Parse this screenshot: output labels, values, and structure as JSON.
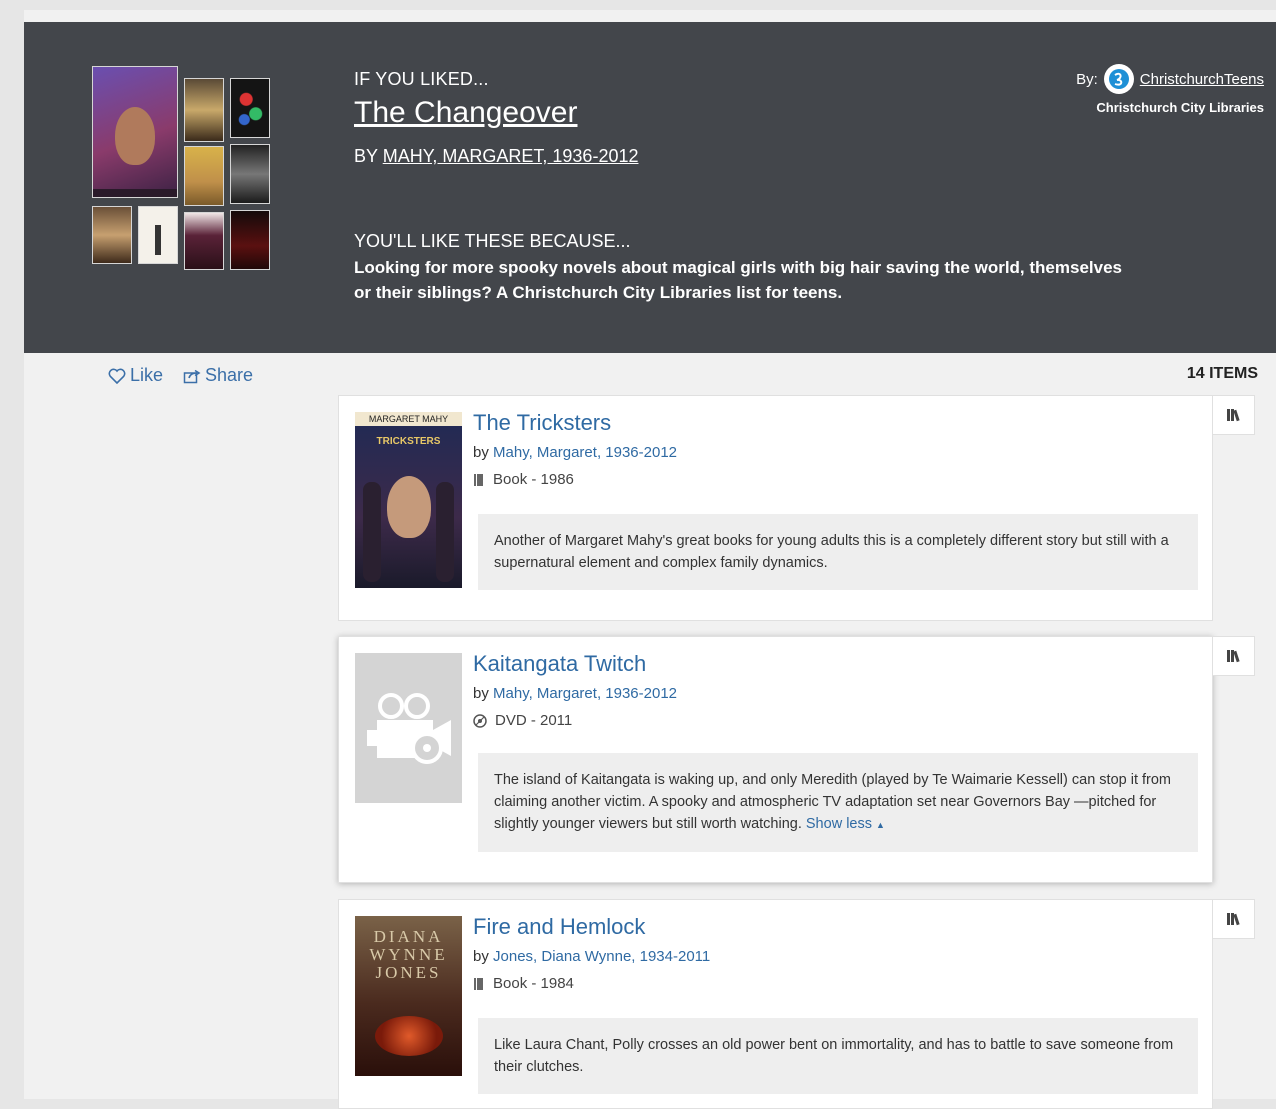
{
  "hero": {
    "label": "IF YOU LIKED...",
    "title": "The Changeover",
    "author_prefix": "BY",
    "author": "MAHY, MARGARET, 1936-2012",
    "because_label": "YOU'LL LIKE THESE BECAUSE...",
    "description": "Looking for more spooky novels about magical girls with big hair saving the world, themselves or their siblings? A Christchurch City Libraries list for teens.",
    "by_label": "By:",
    "by_user": "ChristchurchTeens",
    "by_org": "Christchurch City Libraries"
  },
  "actions": {
    "like": "Like",
    "share": "Share"
  },
  "items_count": "14 ITEMS",
  "items": [
    {
      "title": "The Tricksters",
      "by": "by",
      "author": "Mahy, Margaret, 1936-2012",
      "format": "Book - 1986",
      "format_icon": "book-icon",
      "note": "Another of Margaret Mahy's great books for young adults this is a completely different story but still with a supernatural element and complex family dynamics.",
      "jacket_text_top": "MARGARET MAHY",
      "jacket_text_title": "TRICKSTERS"
    },
    {
      "title": "Kaitangata Twitch",
      "by": "by",
      "author": "Mahy, Margaret, 1936-2012",
      "format": "DVD - 2011",
      "format_icon": "dvd-icon",
      "note": "The island of Kaitangata is waking up, and only Meredith (played by Te Waimarie Kessell) can stop it from claiming another victim. A spooky and atmospheric TV adaptation set near Governors Bay —pitched for slightly younger viewers but still worth watching.",
      "show_less": "Show less"
    },
    {
      "title": "Fire and Hemlock",
      "by": "by",
      "author": "Jones, Diana Wynne, 1934-2011",
      "format": "Book - 1984",
      "format_icon": "book-icon",
      "note": "Like Laura Chant, Polly crosses an old power bent on immortality, and has to battle to save someone from their clutches.",
      "jacket_text_title": "DIANA WYNNE JONES"
    }
  ],
  "colors": {
    "hero_bg": "#43464b",
    "link": "#2f6aa3",
    "note_bg": "#eeeeee"
  }
}
